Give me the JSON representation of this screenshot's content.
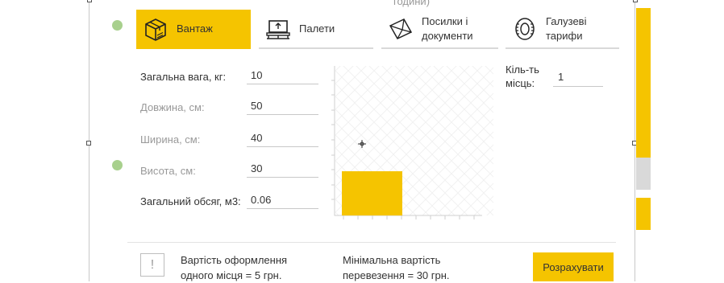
{
  "tabs": [
    {
      "label": "Вантаж",
      "icon": "box-icon",
      "active": true
    },
    {
      "label": "Палети",
      "icon": "pallet-icon",
      "active": false
    },
    {
      "label": "Посилки і документи",
      "icon": "envelope-icon",
      "active": false
    },
    {
      "label": "Галузеві тарифи",
      "icon": "tire-icon",
      "active": false
    }
  ],
  "top_overflow_text": "години)",
  "form": {
    "weight": {
      "label": "Загальна вага, кг:",
      "value": "10"
    },
    "length": {
      "label": "Довжина, см:",
      "value": "50"
    },
    "width": {
      "label": "Ширина, см:",
      "value": "40"
    },
    "height": {
      "label": "Висота, см:",
      "value": "30"
    },
    "volume": {
      "label": "Загальний обсяг, м3:",
      "value": "0.06"
    }
  },
  "places": {
    "label": "Кіль-ть місць:",
    "value": "1"
  },
  "footer": {
    "notice_icon": "!",
    "registration_cost": "Вартість оформлення одного місця = 5 грн.",
    "min_cost": "Мінімальна вартість перевезення = 30 грн.",
    "calculate_button": "Розрахувати"
  },
  "colors": {
    "accent": "#f5c400",
    "green_marker": "#a8d08d"
  }
}
